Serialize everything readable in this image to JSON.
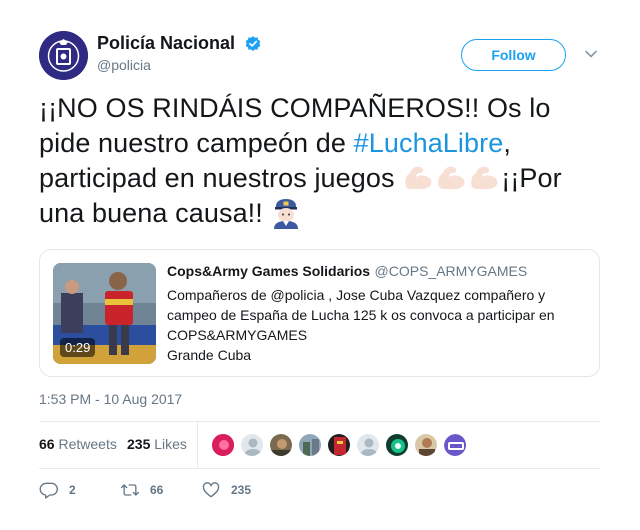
{
  "author": {
    "display_name": "Policía Nacional",
    "handle": "@policia",
    "verified_icon": "verified-badge-icon"
  },
  "follow_label": "Follow",
  "tweet": {
    "line1": "¡¡NO OS RINDÁIS COMPAÑEROS!! Os lo pide nuestro campeón de ",
    "hashtag": "#LuchaLibre",
    "line2": ", participad en nuestros juegos ",
    "line3": "¡¡Por una buena causa!! "
  },
  "card": {
    "author": "Cops&Army Games Solidarios",
    "handle": "@COPS_ARMYGAMES",
    "text": "Compañeros de @policia , Jose Cuba Vazquez compañero y campeo de España de Lucha 125 k os convoca a participar en COPS&ARMYGAMES",
    "text2": "Grande Cuba",
    "duration": "0:29"
  },
  "timestamp": "1:53 PM - 10 Aug 2017",
  "stats": {
    "retweets_count": "66",
    "retweets_label": "Retweets",
    "likes_count": "235",
    "likes_label": "Likes"
  },
  "actions": {
    "reply_count": "2",
    "retweet_count": "66",
    "like_count": "235"
  },
  "colors": {
    "link": "#1b95e0",
    "follow": "#1da1f2",
    "secondary_text": "#657786"
  }
}
